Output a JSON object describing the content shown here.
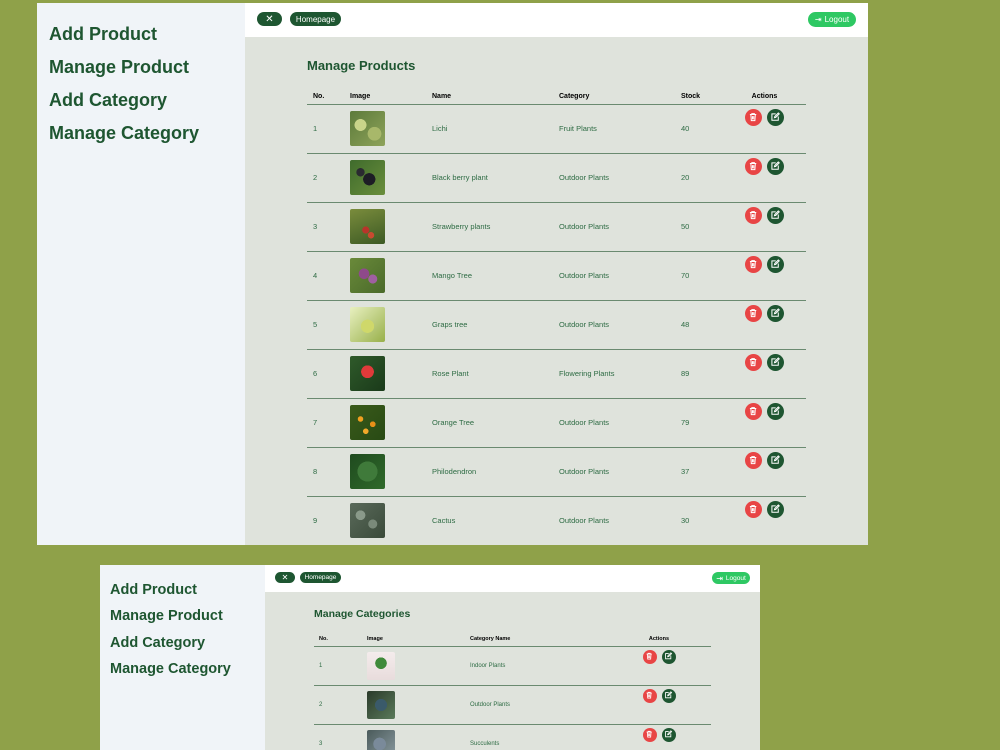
{
  "sidebar": {
    "items": [
      {
        "label": "Add Product"
      },
      {
        "label": "Manage Product"
      },
      {
        "label": "Add Category"
      },
      {
        "label": "Manage Category"
      }
    ]
  },
  "topbar": {
    "close_icon": "close-icon",
    "homepage_label": "Homepage",
    "logout_label": "Logout",
    "logout_icon": "logout-icon"
  },
  "colors": {
    "page_background": "#8fa149",
    "primary": "#1e5631",
    "logout": "#2ec863",
    "delete": "#e84545",
    "sidebar": "#f0f4f8",
    "content": "#dfe3dc"
  },
  "products": {
    "title": "Manage Products",
    "columns": {
      "no": "No.",
      "image": "Image",
      "name": "Name",
      "category": "Category",
      "stock": "Stock",
      "actions": "Actions"
    },
    "rows": [
      {
        "no": "1",
        "name": "Lichi",
        "category": "Fruit Plants",
        "stock": "40",
        "image_hint": "green-leaves-photo"
      },
      {
        "no": "2",
        "name": "Black berry plant",
        "category": "Outdoor Plants",
        "stock": "20",
        "image_hint": "blackberry-photo"
      },
      {
        "no": "3",
        "name": "Strawberry plants",
        "category": "Outdoor Plants",
        "stock": "50",
        "image_hint": "strawberry-photo"
      },
      {
        "no": "4",
        "name": "Mango Tree",
        "category": "Outdoor Plants",
        "stock": "70",
        "image_hint": "mango-flowers-photo"
      },
      {
        "no": "5",
        "name": "Graps tree",
        "category": "Outdoor Plants",
        "stock": "48",
        "image_hint": "grapes-photo"
      },
      {
        "no": "6",
        "name": "Rose Plant",
        "category": "Flowering Plants",
        "stock": "89",
        "image_hint": "rose-photo"
      },
      {
        "no": "7",
        "name": "Orange Tree",
        "category": "Outdoor Plants",
        "stock": "79",
        "image_hint": "orange-tree-photo"
      },
      {
        "no": "8",
        "name": "Philodendron",
        "category": "Outdoor Plants",
        "stock": "37",
        "image_hint": "philodendron-photo"
      },
      {
        "no": "9",
        "name": "Cactus",
        "category": "Outdoor Plants",
        "stock": "30",
        "image_hint": "cactus-photo"
      }
    ]
  },
  "categories": {
    "title": "Manage Categories",
    "columns": {
      "no": "No.",
      "image": "Image",
      "name": "Category Name",
      "actions": "Actions"
    },
    "rows": [
      {
        "no": "1",
        "name": "Indoor Plants",
        "image_hint": "potted-plant-photo"
      },
      {
        "no": "2",
        "name": "Outdoor Plants",
        "image_hint": "outdoor-plants-photo"
      },
      {
        "no": "3",
        "name": "Succulents",
        "image_hint": "succulents-photo"
      }
    ]
  }
}
